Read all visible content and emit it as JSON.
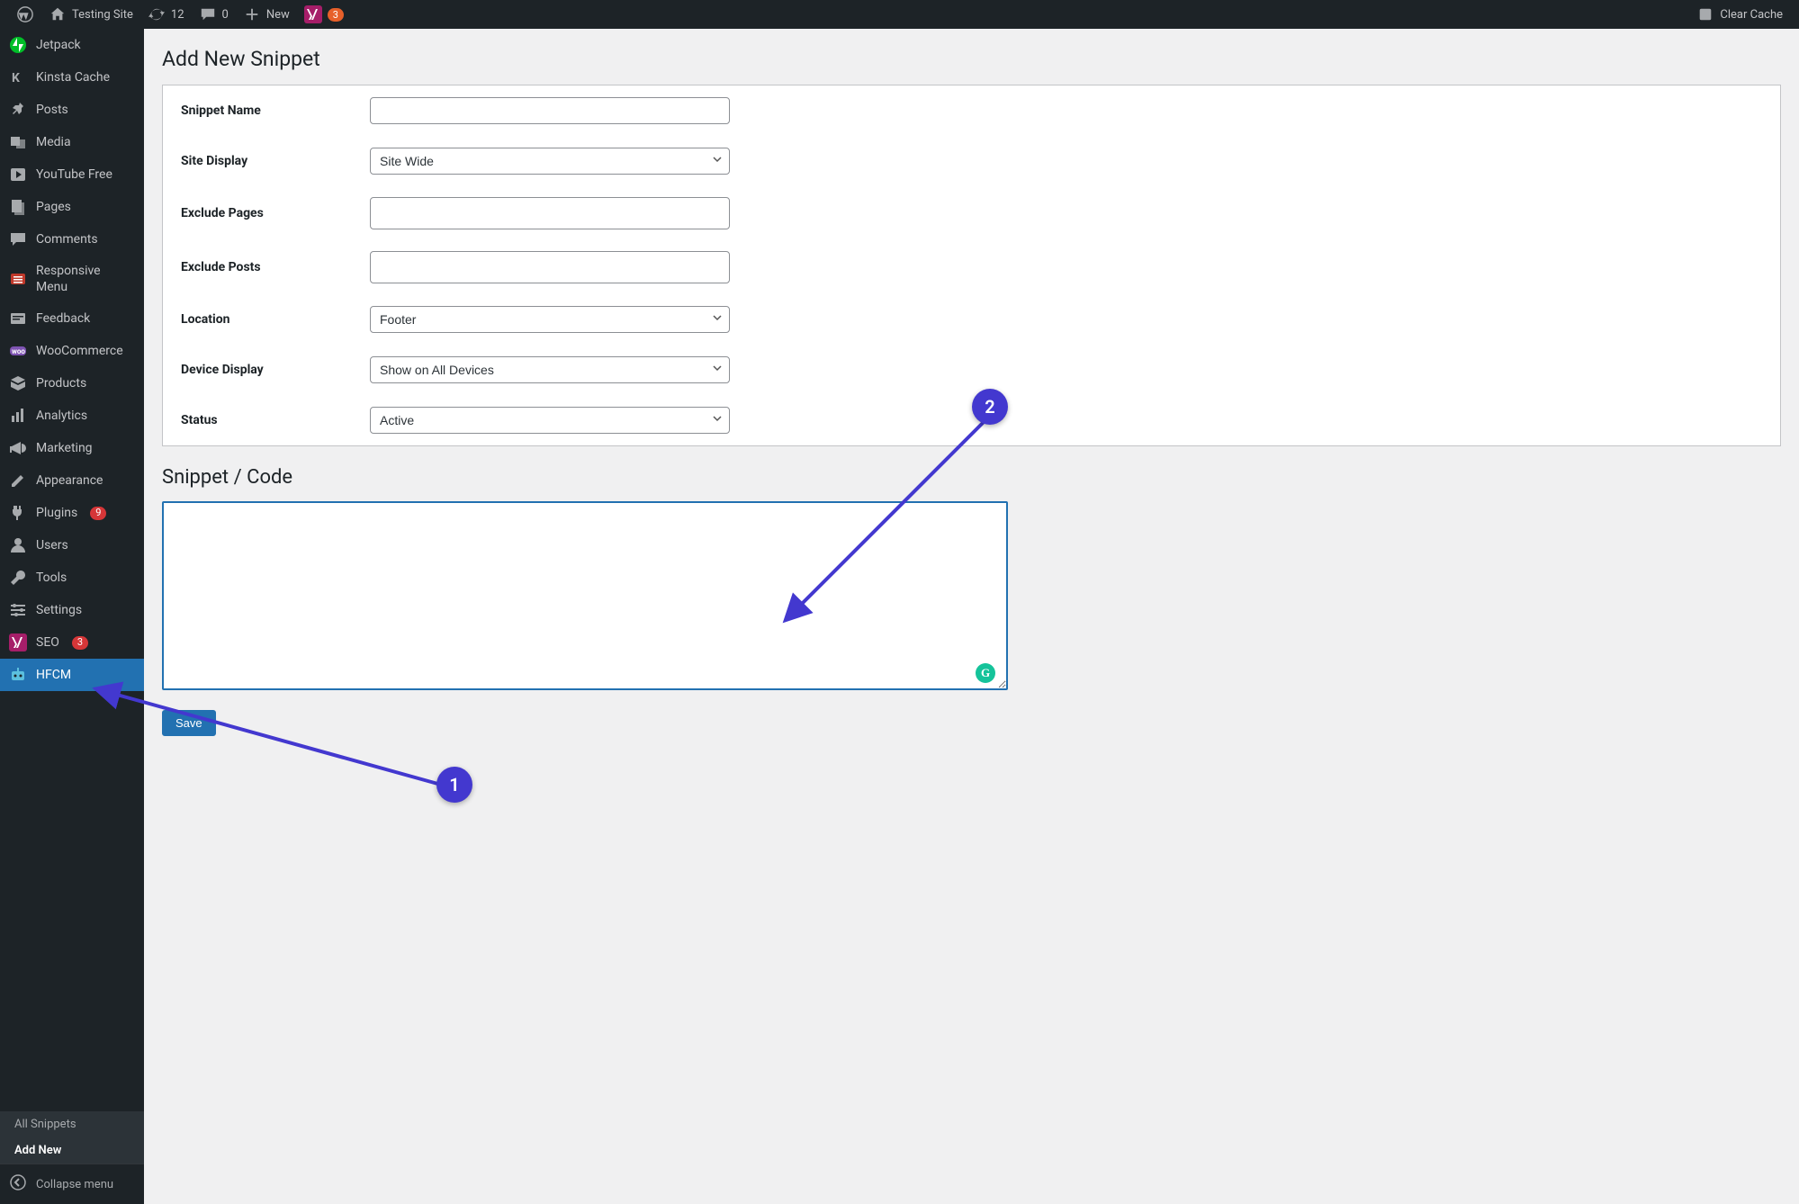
{
  "adminbar": {
    "site_name": "Testing Site",
    "updates_count": "12",
    "comments_count": "0",
    "new_label": "New",
    "yoast_count": "3",
    "clear_cache": "Clear Cache"
  },
  "sidebar": {
    "items": [
      {
        "id": "jetpack",
        "label": "Jetpack",
        "icon": "jetpack"
      },
      {
        "id": "kinsta-cache",
        "label": "Kinsta Cache",
        "icon": "kinsta"
      },
      {
        "id": "posts",
        "label": "Posts",
        "icon": "pin"
      },
      {
        "id": "media",
        "label": "Media",
        "icon": "media"
      },
      {
        "id": "youtube-free",
        "label": "YouTube Free",
        "icon": "play"
      },
      {
        "id": "pages",
        "label": "Pages",
        "icon": "pages"
      },
      {
        "id": "comments",
        "label": "Comments",
        "icon": "comment"
      },
      {
        "id": "responsive-menu",
        "label": "Responsive Menu",
        "icon": "rmenu"
      },
      {
        "id": "feedback",
        "label": "Feedback",
        "icon": "feedback"
      },
      {
        "id": "woocommerce",
        "label": "WooCommerce",
        "icon": "woo"
      },
      {
        "id": "products",
        "label": "Products",
        "icon": "box"
      },
      {
        "id": "analytics",
        "label": "Analytics",
        "icon": "chart"
      },
      {
        "id": "marketing",
        "label": "Marketing",
        "icon": "megaphone"
      },
      {
        "id": "appearance",
        "label": "Appearance",
        "icon": "brush"
      },
      {
        "id": "plugins",
        "label": "Plugins",
        "icon": "plug",
        "badge": "9"
      },
      {
        "id": "users",
        "label": "Users",
        "icon": "user"
      },
      {
        "id": "tools",
        "label": "Tools",
        "icon": "wrench"
      },
      {
        "id": "settings",
        "label": "Settings",
        "icon": "sliders"
      },
      {
        "id": "seo",
        "label": "SEO",
        "icon": "yoast",
        "badge": "3"
      },
      {
        "id": "hfcm",
        "label": "HFCM",
        "icon": "robot",
        "current": true
      }
    ],
    "submenu": [
      {
        "label": "All Snippets",
        "current": false
      },
      {
        "label": "Add New",
        "current": true
      }
    ],
    "collapse_label": "Collapse menu"
  },
  "page": {
    "title": "Add New Snippet",
    "section_title": "Snippet / Code",
    "save_label": "Save"
  },
  "form": {
    "snippet_name": {
      "label": "Snippet Name",
      "value": ""
    },
    "site_display": {
      "label": "Site Display",
      "value": "Site Wide"
    },
    "exclude_pages": {
      "label": "Exclude Pages",
      "value": ""
    },
    "exclude_posts": {
      "label": "Exclude Posts",
      "value": ""
    },
    "location": {
      "label": "Location",
      "value": "Footer"
    },
    "device_display": {
      "label": "Device Display",
      "value": "Show on All Devices"
    },
    "status": {
      "label": "Status",
      "value": "Active"
    },
    "code": {
      "value": ""
    }
  },
  "annotations": {
    "marker1": "1",
    "marker2": "2"
  }
}
